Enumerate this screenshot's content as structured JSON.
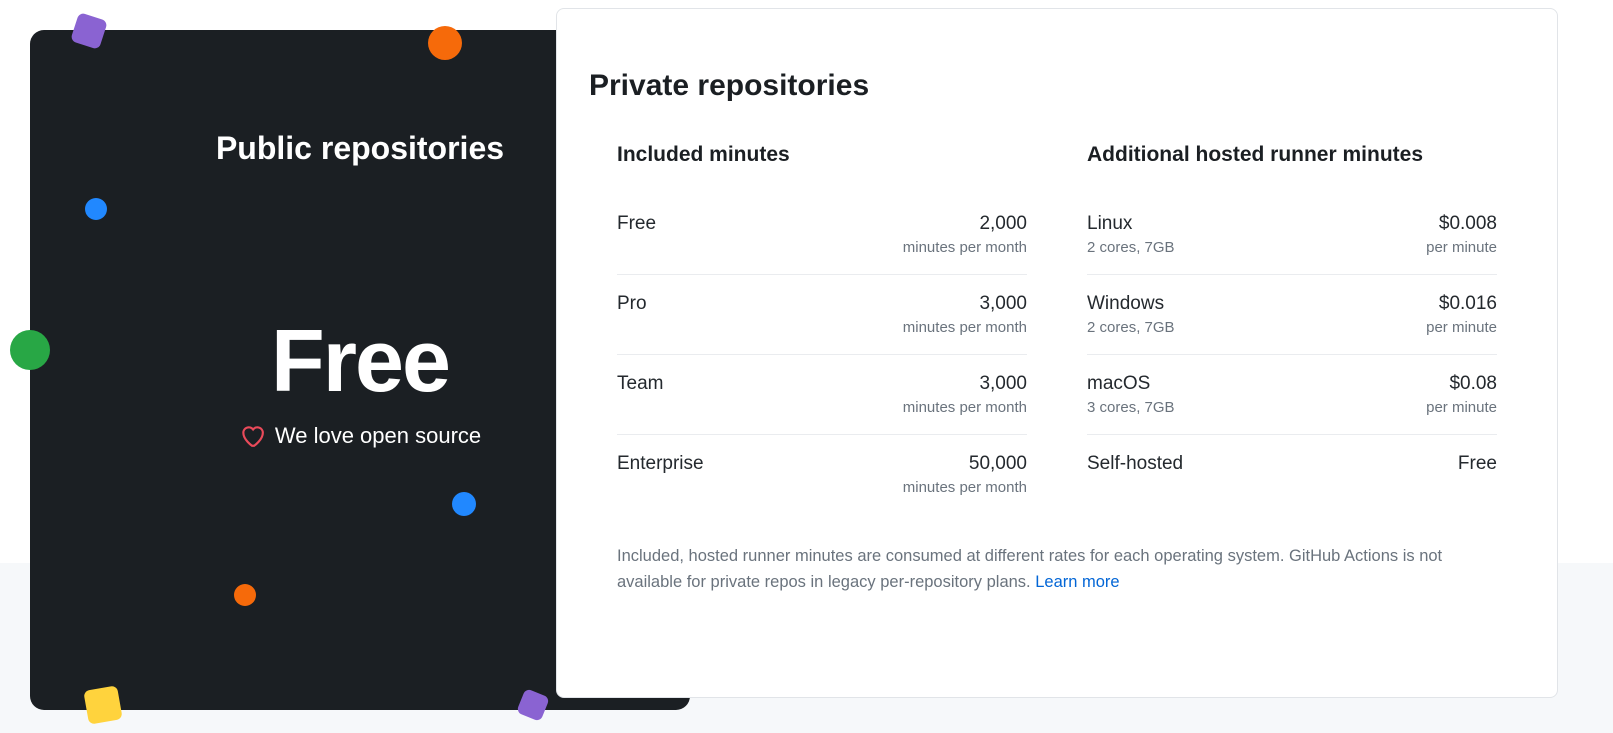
{
  "left": {
    "title": "Public repositories",
    "big": "Free",
    "subtitle": "We love open source"
  },
  "right": {
    "title": "Private repositories",
    "included_heading": "Included minutes",
    "additional_heading": "Additional hosted runner minutes",
    "included": [
      {
        "plan": "Free",
        "amount": "2,000",
        "unit": "minutes per month"
      },
      {
        "plan": "Pro",
        "amount": "3,000",
        "unit": "minutes per month"
      },
      {
        "plan": "Team",
        "amount": "3,000",
        "unit": "minutes per month"
      },
      {
        "plan": "Enterprise",
        "amount": "50,000",
        "unit": "minutes per month"
      }
    ],
    "additional": [
      {
        "os": "Linux",
        "spec": "2 cores, 7GB",
        "price": "$0.008",
        "unit": "per minute"
      },
      {
        "os": "Windows",
        "spec": "2 cores, 7GB",
        "price": "$0.016",
        "unit": "per minute"
      },
      {
        "os": "macOS",
        "spec": "3 cores, 7GB",
        "price": "$0.08",
        "unit": "per minute"
      },
      {
        "os": "Self-hosted",
        "spec": "",
        "price": "Free",
        "unit": ""
      }
    ],
    "footnote": "Included, hosted runner minutes are consumed at different rates for each operating system. GitHub Actions is not available for private repos in legacy per-repository plans. ",
    "learn_more": "Learn more"
  }
}
